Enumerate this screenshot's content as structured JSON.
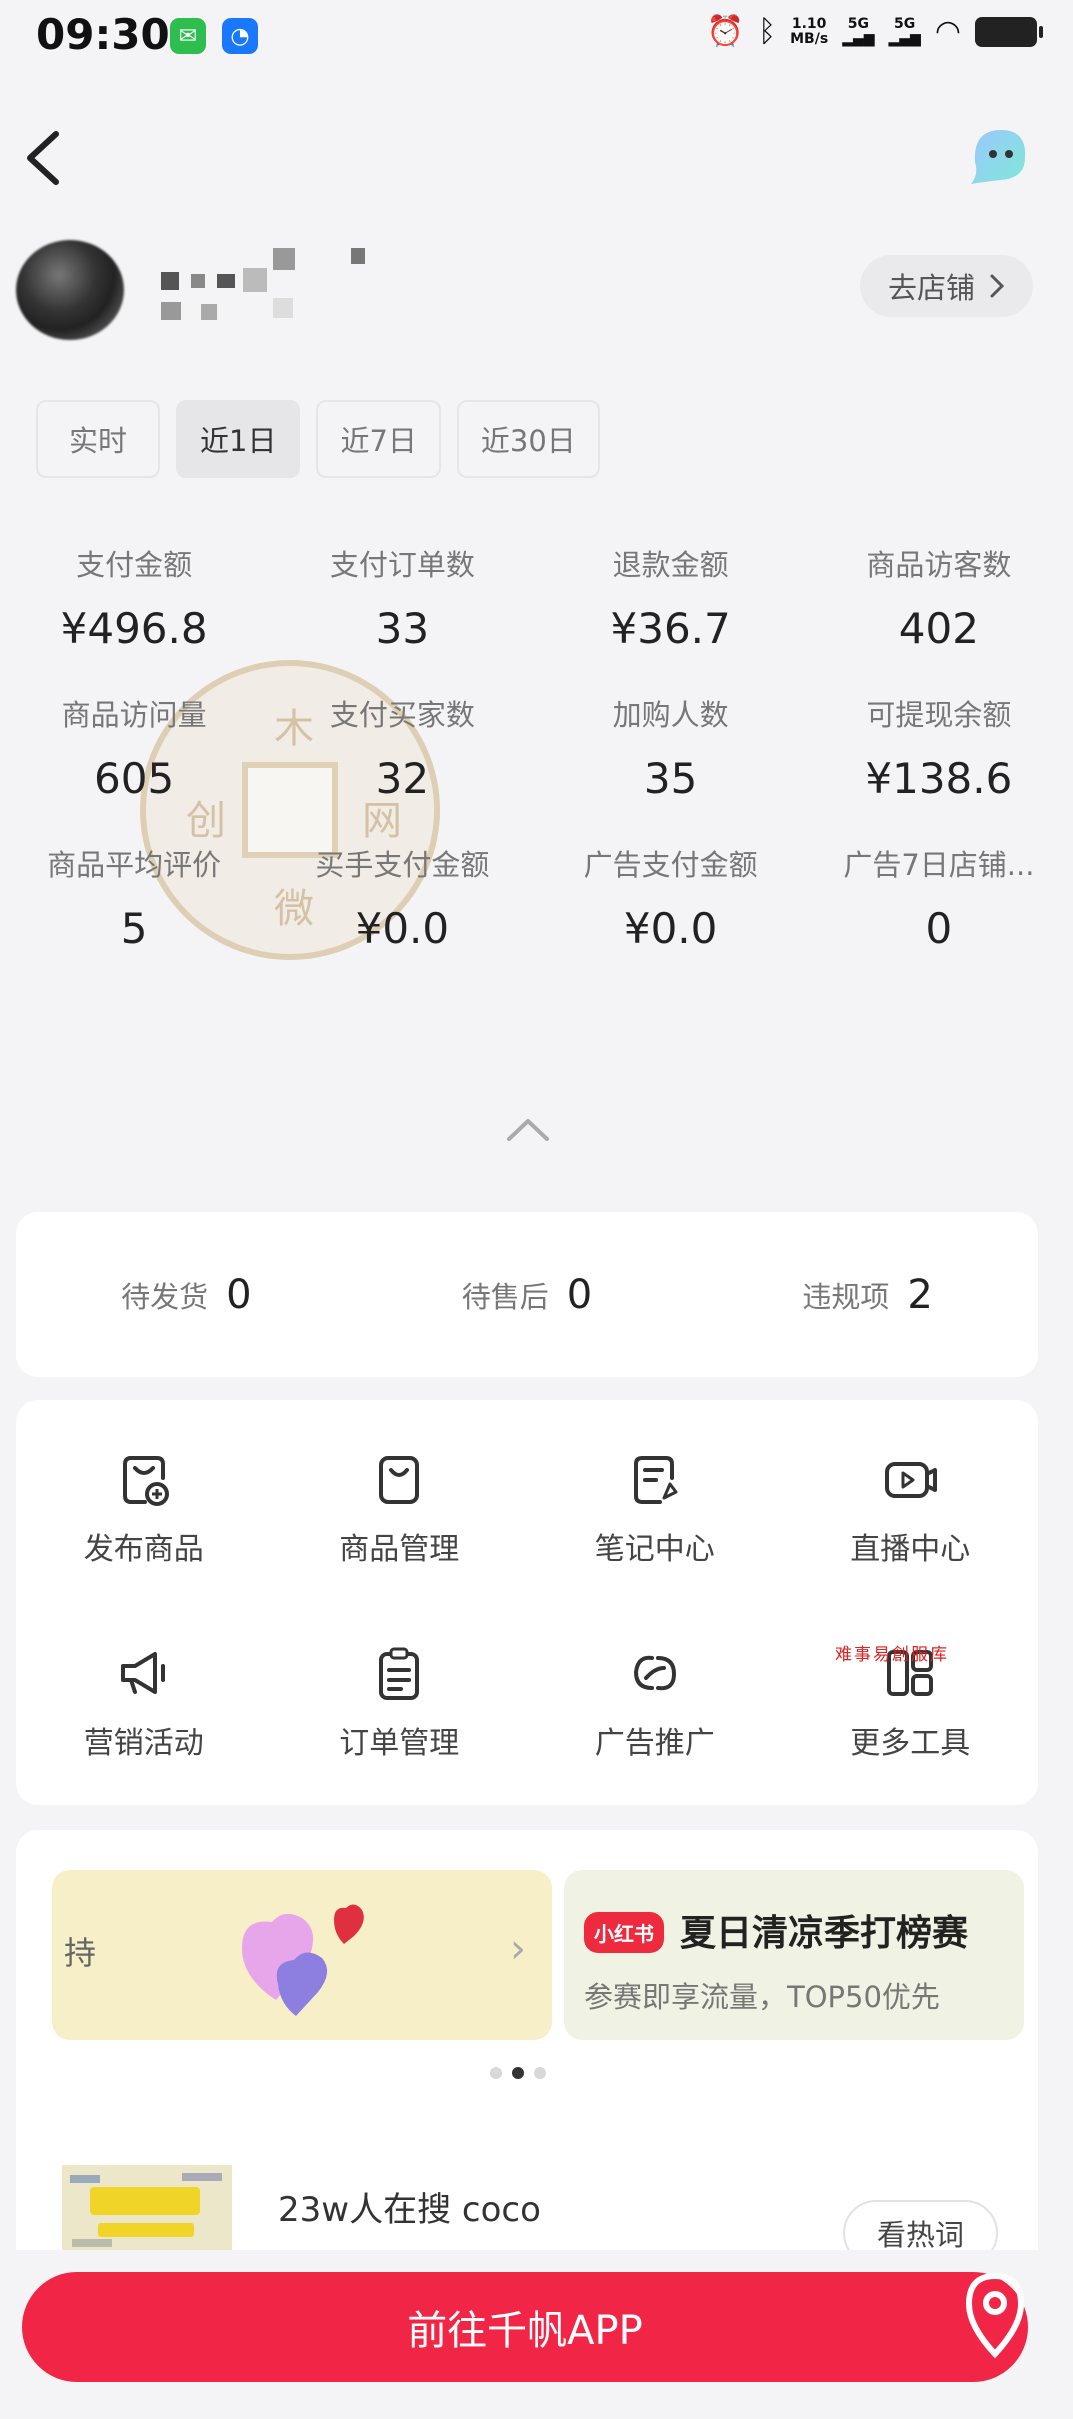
{
  "status": {
    "time": "09:30",
    "network_speed_top": "1.10",
    "network_speed_bottom": "MB/s",
    "signal1": "5G",
    "signal2": "5G"
  },
  "header": {
    "store_button": "去店铺"
  },
  "tabs": [
    {
      "label": "实时"
    },
    {
      "label": "近1日"
    },
    {
      "label": "近7日"
    },
    {
      "label": "近30日"
    }
  ],
  "metrics": [
    {
      "label": "支付金额",
      "value": "¥496.8"
    },
    {
      "label": "支付订单数",
      "value": "33"
    },
    {
      "label": "退款金额",
      "value": "¥36.7"
    },
    {
      "label": "商品访客数",
      "value": "402"
    },
    {
      "label": "商品访问量",
      "value": "605"
    },
    {
      "label": "支付买家数",
      "value": "32"
    },
    {
      "label": "加购人数",
      "value": "35"
    },
    {
      "label": "可提现余额",
      "value": "¥138.6"
    },
    {
      "label": "商品平均评价",
      "value": "5"
    },
    {
      "label": "买手支付金额",
      "value": "¥0.0"
    },
    {
      "label": "广告支付金额",
      "value": "¥0.0"
    },
    {
      "label": "广告7日店铺...",
      "value": "0"
    }
  ],
  "todos": [
    {
      "label": "待发货",
      "value": "0"
    },
    {
      "label": "待售后",
      "value": "0"
    },
    {
      "label": "违规项",
      "value": "2"
    }
  ],
  "tools": [
    {
      "label": "发布商品",
      "icon": "publish-product-icon"
    },
    {
      "label": "商品管理",
      "icon": "product-bag-icon"
    },
    {
      "label": "笔记中心",
      "icon": "note-icon"
    },
    {
      "label": "直播中心",
      "icon": "live-camera-icon"
    },
    {
      "label": "营销活动",
      "icon": "megaphone-icon"
    },
    {
      "label": "订单管理",
      "icon": "clipboard-icon"
    },
    {
      "label": "广告推广",
      "icon": "ad-promo-icon"
    },
    {
      "label": "更多工具",
      "icon": "more-tools-icon"
    }
  ],
  "banners": {
    "banner1_text": "持",
    "banner2_logo": "小红书",
    "banner2_title": "夏日清凉季打榜赛",
    "banner2_subtitle": "参赛即享流量，TOP50优先"
  },
  "hot_search": {
    "text": "23w人在搜 coco",
    "button": "看热词"
  },
  "cta": "前往千帆APP",
  "watermark_chars": [
    "木",
    "创",
    "网",
    "微"
  ],
  "red_note": "难事易創服库",
  "colors": {
    "accent": "#f12646",
    "background": "#f4f4f6"
  }
}
